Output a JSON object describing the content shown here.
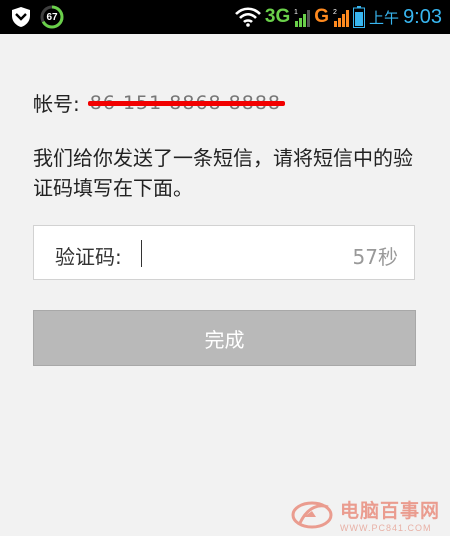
{
  "status_bar": {
    "battery_percent": "67",
    "network_1": "3G",
    "network_2": "G",
    "sim_1_badge": "1",
    "sim_2_badge": "2",
    "clock_ampm": "上午",
    "clock_time": "9:03",
    "icons": [
      "shield-icon",
      "battery-percent-icon",
      "wifi-icon",
      "signal-icon",
      "battery-icon"
    ]
  },
  "account": {
    "label": "帐号:",
    "value": "86 151 8868 8888"
  },
  "message": "我们给你发送了一条短信，请将短信中的验证码填写在下面。",
  "verification": {
    "label": "验证码:",
    "value": "",
    "countdown": "57秒"
  },
  "done_button_label": "完成",
  "watermark": {
    "title": "电脑百事网",
    "url": "WWW.PC841.COM"
  },
  "colors": {
    "background": "#f2f2f2",
    "status_bar": "#000000",
    "network_3g": "#6ad04a",
    "network_g": "#ff8a1f",
    "clock": "#38b6f0",
    "redaction": "#f20000",
    "button_disabled": "#b9b9b9"
  }
}
